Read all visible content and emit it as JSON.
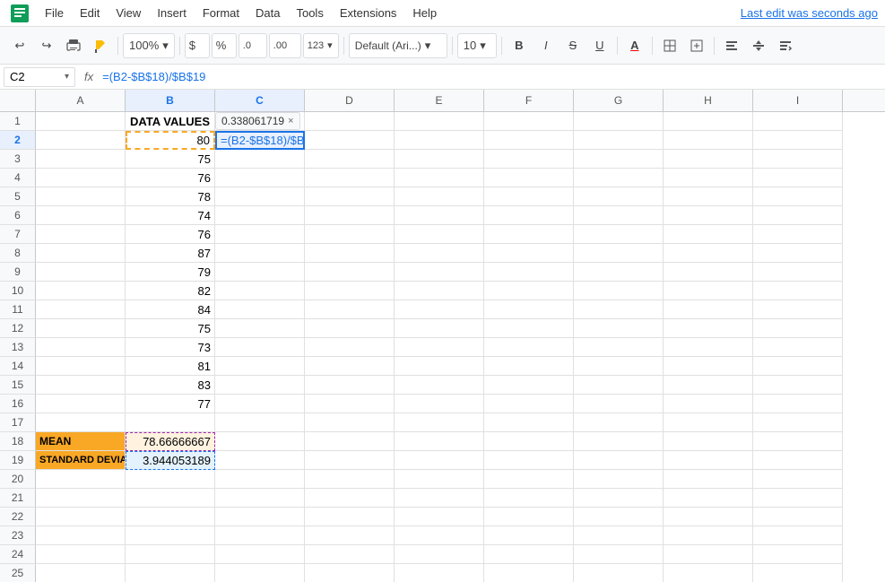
{
  "menu": {
    "logo_text": "G",
    "items": [
      "File",
      "Edit",
      "View",
      "Insert",
      "Format",
      "Data",
      "Tools",
      "Extensions",
      "Help"
    ],
    "last_edit": "Last edit was seconds ago"
  },
  "toolbar": {
    "undo": "↩",
    "redo": "↪",
    "print": "🖨",
    "paintformat": "🖌",
    "zoom": "100%",
    "currency": "$",
    "percent": "%",
    "decimal0": ".0",
    "decimal00": ".00",
    "more_formats": "123",
    "font_family": "Default (Ari...)",
    "font_size": "10",
    "bold": "B",
    "italic": "I",
    "strikethrough": "S",
    "underline": "U",
    "fill_color": "A",
    "borders": "⊞",
    "merge": "⊡",
    "align": "≡",
    "valign": "⊤",
    "wrap": "↵"
  },
  "formula_bar": {
    "cell_ref": "C2",
    "fx": "fx",
    "formula": "=(B2-$B$18)/$B$19"
  },
  "columns": [
    "A",
    "B",
    "C",
    "D",
    "E",
    "F",
    "G",
    "H",
    "I"
  ],
  "rows": [
    {
      "num": 1,
      "a": "",
      "b": "DATA VALUES",
      "c": "",
      "d": "",
      "e": "",
      "f": "",
      "g": "",
      "h": "",
      "i": ""
    },
    {
      "num": 2,
      "a": "",
      "b": "80",
      "c": "=(B2-$B$18)/$B$19",
      "d": "",
      "e": "",
      "f": "",
      "g": "",
      "h": "",
      "i": ""
    },
    {
      "num": 3,
      "a": "",
      "b": "75",
      "c": "",
      "d": "",
      "e": "",
      "f": "",
      "g": "",
      "h": "",
      "i": ""
    },
    {
      "num": 4,
      "a": "",
      "b": "76",
      "c": "",
      "d": "",
      "e": "",
      "f": "",
      "g": "",
      "h": "",
      "i": ""
    },
    {
      "num": 5,
      "a": "",
      "b": "78",
      "c": "",
      "d": "",
      "e": "",
      "f": "",
      "g": "",
      "h": "",
      "i": ""
    },
    {
      "num": 6,
      "a": "",
      "b": "74",
      "c": "",
      "d": "",
      "e": "",
      "f": "",
      "g": "",
      "h": "",
      "i": ""
    },
    {
      "num": 7,
      "a": "",
      "b": "76",
      "c": "",
      "d": "",
      "e": "",
      "f": "",
      "g": "",
      "h": "",
      "i": ""
    },
    {
      "num": 8,
      "a": "",
      "b": "87",
      "c": "",
      "d": "",
      "e": "",
      "f": "",
      "g": "",
      "h": "",
      "i": ""
    },
    {
      "num": 9,
      "a": "",
      "b": "79",
      "c": "",
      "d": "",
      "e": "",
      "f": "",
      "g": "",
      "h": "",
      "i": ""
    },
    {
      "num": 10,
      "a": "",
      "b": "82",
      "c": "",
      "d": "",
      "e": "",
      "f": "",
      "g": "",
      "h": "",
      "i": ""
    },
    {
      "num": 11,
      "a": "",
      "b": "84",
      "c": "",
      "d": "",
      "e": "",
      "f": "",
      "g": "",
      "h": "",
      "i": ""
    },
    {
      "num": 12,
      "a": "",
      "b": "75",
      "c": "",
      "d": "",
      "e": "",
      "f": "",
      "g": "",
      "h": "",
      "i": ""
    },
    {
      "num": 13,
      "a": "",
      "b": "73",
      "c": "",
      "d": "",
      "e": "",
      "f": "",
      "g": "",
      "h": "",
      "i": ""
    },
    {
      "num": 14,
      "a": "",
      "b": "81",
      "c": "",
      "d": "",
      "e": "",
      "f": "",
      "g": "",
      "h": "",
      "i": ""
    },
    {
      "num": 15,
      "a": "",
      "b": "83",
      "c": "",
      "d": "",
      "e": "",
      "f": "",
      "g": "",
      "h": "",
      "i": ""
    },
    {
      "num": 16,
      "a": "",
      "b": "77",
      "c": "",
      "d": "",
      "e": "",
      "f": "",
      "g": "",
      "h": "",
      "i": ""
    },
    {
      "num": 17,
      "a": "",
      "b": "",
      "c": "",
      "d": "",
      "e": "",
      "f": "",
      "g": "",
      "h": "",
      "i": ""
    },
    {
      "num": 18,
      "a": "MEAN",
      "b": "78.66666667",
      "c": "",
      "d": "",
      "e": "",
      "f": "",
      "g": "",
      "h": "",
      "i": "",
      "label": true
    },
    {
      "num": 19,
      "a": "STANDARD DEVIATION",
      "b": "3.944053189",
      "c": "",
      "d": "",
      "e": "",
      "f": "",
      "g": "",
      "h": "",
      "i": "",
      "label": true
    },
    {
      "num": 20,
      "a": "",
      "b": "",
      "c": "",
      "d": "",
      "e": "",
      "f": "",
      "g": "",
      "h": "",
      "i": ""
    },
    {
      "num": 21,
      "a": "",
      "b": "",
      "c": "",
      "d": "",
      "e": "",
      "f": "",
      "g": "",
      "h": "",
      "i": ""
    },
    {
      "num": 22,
      "a": "",
      "b": "",
      "c": "",
      "d": "",
      "e": "",
      "f": "",
      "g": "",
      "h": "",
      "i": ""
    },
    {
      "num": 23,
      "a": "",
      "b": "",
      "c": "",
      "d": "",
      "e": "",
      "f": "",
      "g": "",
      "h": "",
      "i": ""
    },
    {
      "num": 24,
      "a": "",
      "b": "",
      "c": "",
      "d": "",
      "e": "",
      "f": "",
      "g": "",
      "h": "",
      "i": ""
    },
    {
      "num": 25,
      "a": "",
      "b": "",
      "c": "",
      "d": "",
      "e": "",
      "f": "",
      "g": "",
      "h": "",
      "i": ""
    }
  ],
  "c2_tooltip": "0.338061719",
  "tooltip_close": "×"
}
